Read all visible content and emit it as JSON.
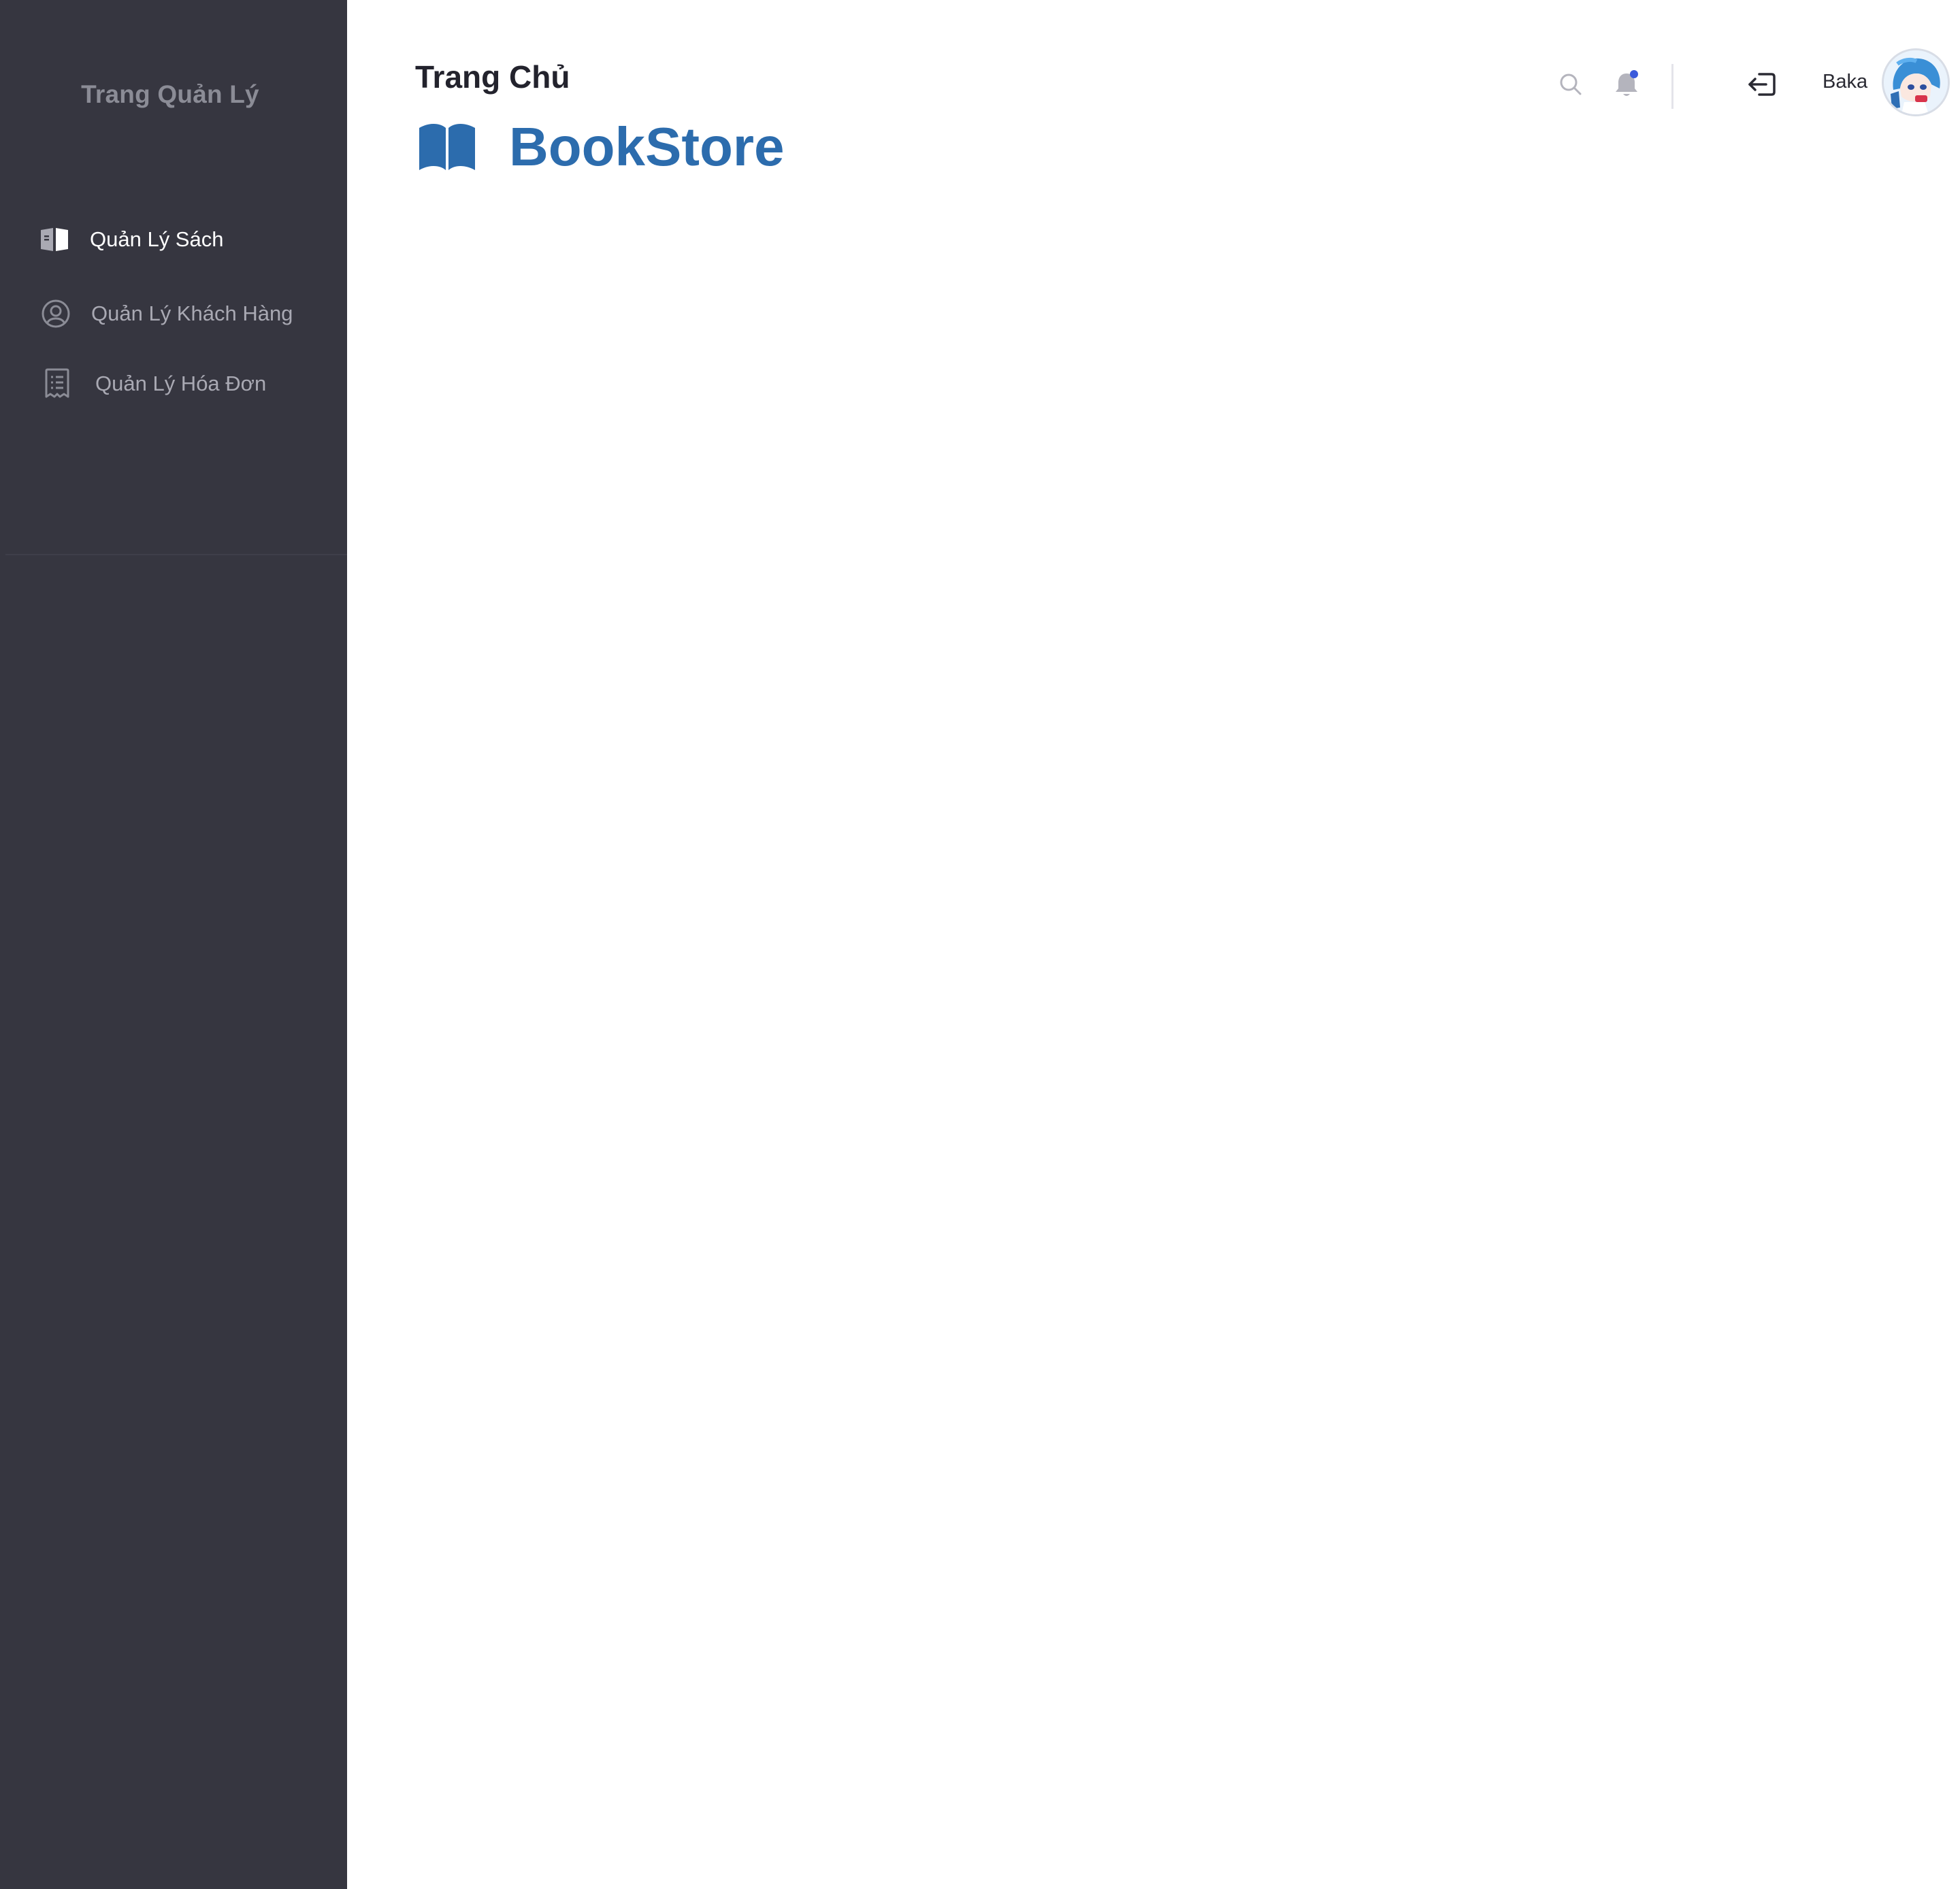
{
  "sidebar": {
    "brand": "Trang Quản Lý",
    "items": [
      {
        "label": "Quản Lý Sách",
        "icon": "book-open-icon",
        "active": true
      },
      {
        "label": "Quản Lý Khách Hàng",
        "icon": "user-circle-icon",
        "active": false
      },
      {
        "label": "Quản Lý Hóa Đơn",
        "icon": "receipt-icon",
        "active": false
      }
    ]
  },
  "header": {
    "title": "Trang Chủ",
    "logo_text": "BookStore",
    "logo_icon": "book-icon"
  },
  "toolbar": {
    "search_icon": "search-icon",
    "notification_icon": "bell-icon",
    "notification_dot": true,
    "logout_icon": "logout-icon",
    "user_name": "Baka"
  },
  "colors": {
    "sidebar_bg": "#363640",
    "brand_text": "#8b8c96",
    "accent": "#2c6cad",
    "notification_dot": "#3b5bdb"
  }
}
